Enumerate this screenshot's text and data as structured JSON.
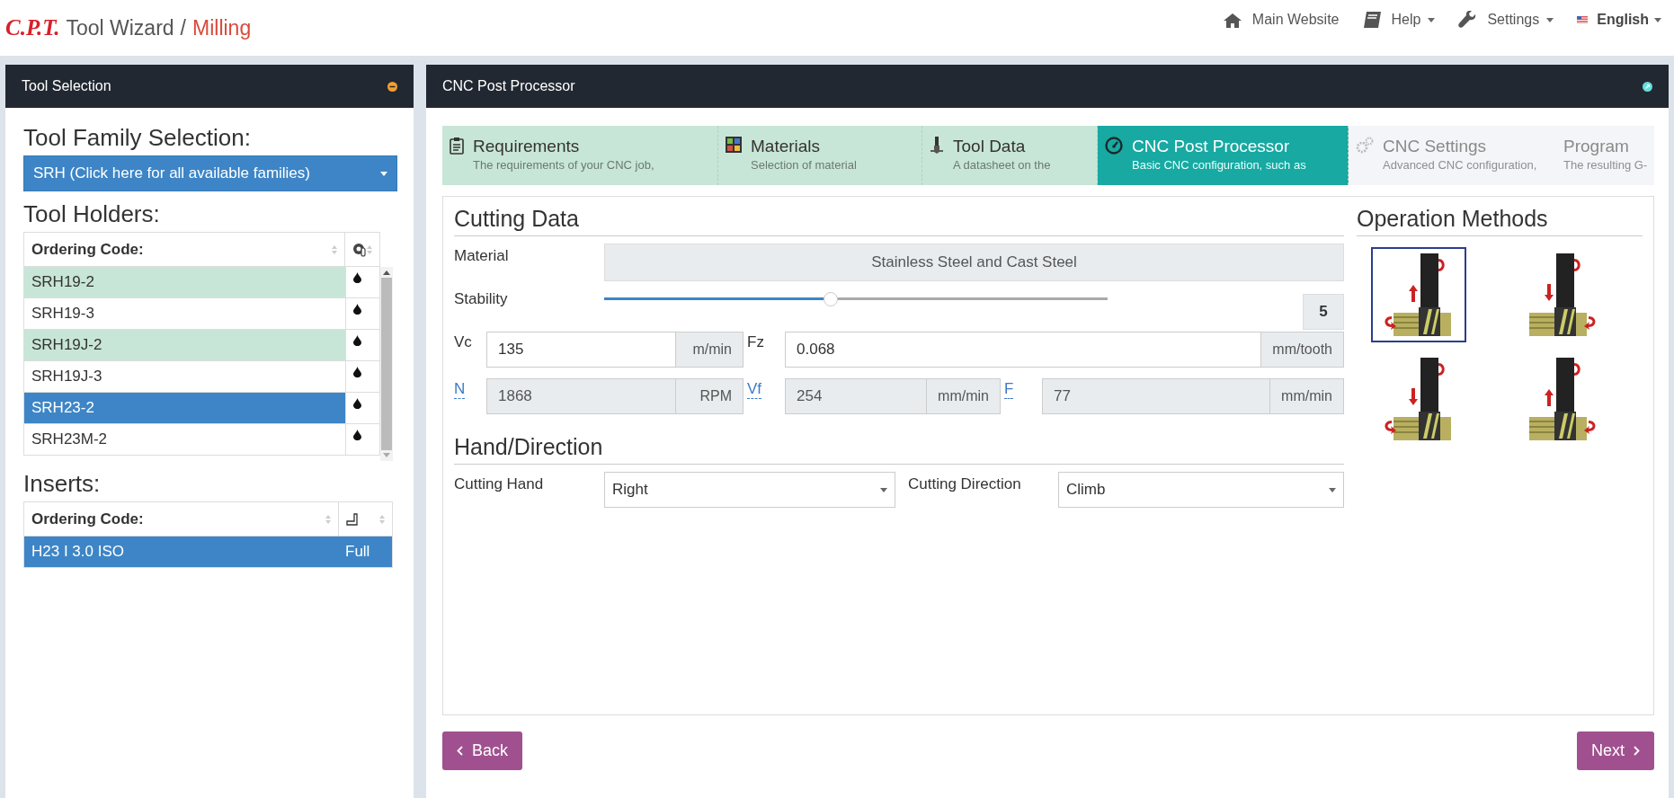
{
  "header": {
    "logo": "C.P.T.",
    "title": "Tool Wizard",
    "separator": "/",
    "section": "Milling",
    "nav": [
      {
        "kind": "home",
        "label": "Main Website",
        "dropdown": false
      },
      {
        "kind": "book",
        "label": "Help",
        "dropdown": true
      },
      {
        "kind": "wrench",
        "label": "Settings",
        "dropdown": true
      },
      {
        "kind": "flag",
        "label": "English",
        "dropdown": true
      }
    ]
  },
  "tool_selection": {
    "title": "Tool Selection",
    "family_heading": "Tool Family Selection:",
    "family_select": "SRH (Click here for all available families)",
    "holders_heading": "Tool Holders:",
    "holders": {
      "columns": [
        "Ordering Code:"
      ],
      "rows": [
        {
          "code": "SRH19-2",
          "highlighted": true,
          "selected": false
        },
        {
          "code": "SRH19-3",
          "highlighted": false,
          "selected": false
        },
        {
          "code": "SRH19J-2",
          "highlighted": true,
          "selected": false
        },
        {
          "code": "SRH19J-3",
          "highlighted": false,
          "selected": false
        },
        {
          "code": "SRH23-2",
          "highlighted": false,
          "selected": true
        },
        {
          "code": "SRH23M-2",
          "highlighted": false,
          "selected": false
        }
      ]
    },
    "inserts_heading": "Inserts:",
    "inserts": {
      "columns": [
        "Ordering Code:"
      ],
      "rows": [
        {
          "code": "H23 I 3.0 ISO",
          "profile": "Full",
          "selected": true
        }
      ]
    }
  },
  "main": {
    "title": "CNC Post Processor",
    "steps": [
      {
        "kind": "clipboard",
        "title": "Requirements",
        "subtitle": "The requirements of your CNC job,",
        "selected": false,
        "disabled": false
      },
      {
        "kind": "grid",
        "title": "Materials",
        "subtitle": "Selection of material",
        "selected": false,
        "disabled": false
      },
      {
        "kind": "tool",
        "title": "Tool Data",
        "subtitle": "A datasheet on the",
        "selected": false,
        "disabled": false
      },
      {
        "kind": "gauge",
        "title": "CNC Post Processor",
        "subtitle": "Basic CNC configuration, such as",
        "selected": true,
        "disabled": false
      },
      {
        "kind": "gears",
        "title": "CNC Settings",
        "subtitle": "Advanced CNC configuration,",
        "selected": false,
        "disabled": true
      },
      {
        "kind": "document",
        "title": "Program",
        "subtitle": "The resulting G-",
        "selected": false,
        "disabled": true
      }
    ],
    "cutting_data": {
      "heading": "Cutting Data",
      "material_label": "Material",
      "material": "Stainless Steel and Cast Steel",
      "stability_label": "Stability",
      "stability": {
        "level": 0.45,
        "reading": "5"
      },
      "rows": [
        [
          {
            "label": "Vc",
            "value": "135",
            "unit": "m/min",
            "readonly": false,
            "link": false
          },
          {
            "label": "Fz",
            "value": "0.068",
            "unit": "mm/tooth",
            "readonly": false,
            "link": false
          }
        ],
        [
          {
            "label": "N",
            "value": "1868",
            "unit": "RPM",
            "readonly": true,
            "link": true
          },
          {
            "label": "Vf",
            "value": "254",
            "unit": "mm/min",
            "readonly": true,
            "link": true
          },
          {
            "label": "F",
            "value": "77",
            "unit": "mm/min",
            "readonly": true,
            "link": true
          }
        ]
      ]
    },
    "hand_direction": {
      "heading": "Hand/Direction",
      "selects": [
        {
          "label": "Cutting Hand",
          "value": "Right"
        },
        {
          "label": "Cutting Direction",
          "value": "Climb"
        }
      ]
    },
    "operation_methods": {
      "heading": "Operation Methods",
      "options": [
        {
          "kind": "picture",
          "selected": true
        },
        {
          "kind": "picture",
          "selected": false
        },
        {
          "kind": "picture",
          "selected": false
        },
        {
          "kind": "picture",
          "selected": false
        }
      ]
    },
    "buttons": [
      {
        "kind": "back",
        "label": "Back"
      },
      {
        "kind": "next",
        "label": "Next"
      }
    ]
  }
}
